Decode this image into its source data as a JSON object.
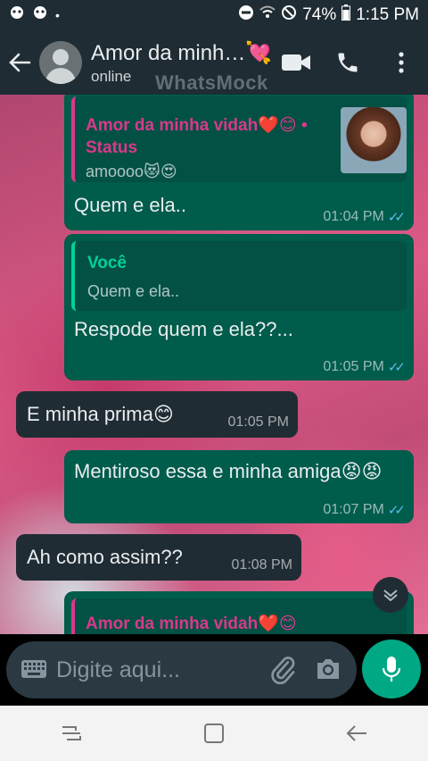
{
  "status_bar": {
    "battery": "74%",
    "time": "1:15 PM"
  },
  "header": {
    "contact_name": "Amor da minh…💘",
    "presence": "online",
    "watermark": "WhatsMock"
  },
  "messages": [
    {
      "dir": "out",
      "quote": {
        "author": "Amor da minha vidah❤️😊 • Status",
        "text": "amoooo😻😍"
      },
      "text": "Quem e ela..",
      "time": "01:04 PM",
      "ticks": "✓✓"
    },
    {
      "dir": "out",
      "quote": {
        "author": "Você",
        "text": "Quem e ela.."
      },
      "text": "Respode quem e ela??...",
      "time": "01:05 PM",
      "ticks": "✓✓"
    },
    {
      "dir": "in",
      "text": "E minha prima😊",
      "time": "01:05 PM"
    },
    {
      "dir": "out",
      "text": "Mentiroso essa e minha amiga😡😡",
      "time": "01:07 PM",
      "ticks": "✓✓"
    },
    {
      "dir": "in",
      "text": "Ah como assim??",
      "time": "01:08 PM"
    },
    {
      "dir": "out",
      "quote": {
        "author": "Amor da minha vidah❤️😊"
      }
    }
  ],
  "input": {
    "placeholder": "Digite aqui..."
  },
  "colors": {
    "outgoing": "#005c4b",
    "incoming": "#202c33",
    "accent": "#00a884",
    "read_ticks": "#53bdeb"
  }
}
